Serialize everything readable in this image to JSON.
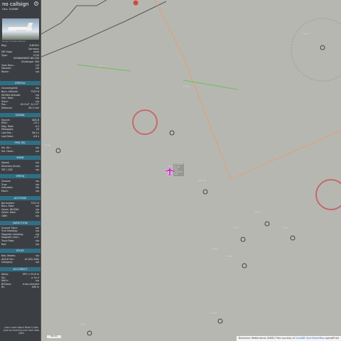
{
  "header": {
    "callsign": "no callsign",
    "hex_label": "Hex:",
    "hex": "3C6B8F"
  },
  "photo_credit": "Image © Günther Pleinen",
  "colors": {
    "sidebar_bg": "#3b3f44",
    "section_bg": "#2f6f86",
    "map_bg": "#b7b7b2",
    "aircraft": "#cc33cc",
    "restricted": "#c46a6a",
    "airway_orange": "#e0a070",
    "airway_green": "#6fbf4f",
    "border": "#555555"
  },
  "details": [
    {
      "k": "Reg.:",
      "v": "D-BGGG"
    },
    {
      "k": "",
      "v": "Germany"
    },
    {
      "k": "DB Flags:",
      "v": "none"
    },
    {
      "k": "Type:",
      "v": "CL30"
    },
    {
      "k": "",
      "v": "BOMBARDIER BD-100"
    },
    {
      "k": "",
      "v": "Challenger 300"
    },
    {
      "k": "Type Desc.:",
      "v": "L2J"
    },
    {
      "k": "Squawk:",
      "v": "n/a"
    },
    {
      "k": "Route:",
      "v": "n/a"
    }
  ],
  "sections": [
    {
      "title": "SPATIAL",
      "rows": [
        {
          "k": "Groundspeed:",
          "v": "n/a"
        },
        {
          "k": "Baro. Altitude:",
          "v": "7325 ft"
        },
        {
          "k": "WGS84 Altitude:",
          "v": "n/a"
        },
        {
          "k": "Vert. Rate:",
          "v": "n/a"
        },
        {
          "k": "Track:",
          "v": "n/a"
        },
        {
          "k": "Pos.:",
          "v": "49.214°, 8.111°"
        },
        {
          "k": "Distance:",
          "v": "60.3 nmi"
        }
      ]
    },
    {
      "title": "SIGNAL",
      "rows": [
        {
          "k": "Source:",
          "v": "ADS-B"
        },
        {
          "k": "RSSI:",
          "v": "-25.1"
        },
        {
          "k": "Msg. Rate:",
          "v": "0.3"
        },
        {
          "k": "Messages:",
          "v": "20"
        },
        {
          "k": "Last Pos.:",
          "v": "58.4 s"
        },
        {
          "k": "Last Seen:",
          "v": "0.6 s"
        }
      ]
    },
    {
      "title": "FMS SEL",
      "rows": [
        {
          "k": "Sel. Alt.:",
          "v": "n/a"
        },
        {
          "k": "Sel. Head.:",
          "v": "n/a"
        }
      ]
    },
    {
      "title": "WIND",
      "rows": [
        {
          "k": "Speed:",
          "v": "n/a"
        },
        {
          "k": "Direction (from):",
          "v": "n/a"
        },
        {
          "k": "TAT / OAT:",
          "v": "n/a"
        }
      ]
    },
    {
      "title": "SPEED",
      "rows": [
        {
          "k": "Ground:",
          "v": "n/a"
        },
        {
          "k": "True:",
          "v": "n/a"
        },
        {
          "k": "Indicated:",
          "v": "n/a"
        },
        {
          "k": "Mach:",
          "v": "n/a"
        }
      ]
    },
    {
      "title": "ALTITUDE",
      "rows": [
        {
          "k": "Barometric:",
          "v": "7325 ft"
        },
        {
          "k": "Baro. Rate:",
          "v": "n/a"
        },
        {
          "k": "Geom. WGS84:",
          "v": "n/a"
        },
        {
          "k": "Geom. Rate:",
          "v": "n/a"
        },
        {
          "k": "QNH:",
          "v": "n/a"
        }
      ]
    },
    {
      "title": "DIRECTION",
      "rows": [
        {
          "k": "Ground Track:",
          "v": "n/a"
        },
        {
          "k": "True Heading:",
          "v": "n/a"
        },
        {
          "k": "Magnetic Heading:",
          "v": "n/a"
        },
        {
          "k": "Magnetic Decl.:",
          "v": "2.3°"
        },
        {
          "k": "Track Rate:",
          "v": "n/a"
        },
        {
          "k": "Roll:",
          "v": "n/a"
        }
      ]
    },
    {
      "title": "STUFF",
      "rows": [
        {
          "k": "Nav. Modes:",
          "v": "n/a"
        },
        {
          "k": "ADS-B Ver.:",
          "v": "v0 (DO-260)"
        },
        {
          "k": "Category:",
          "v": "n/a"
        }
      ]
    },
    {
      "title": "ACCURACY",
      "rows": [
        {
          "k": "NACp:",
          "v": "EPU < 92.6 m"
        },
        {
          "k": "SIL:",
          "v": "≤ 1e-3"
        },
        {
          "k": "NACv:",
          "v": "n/a"
        },
        {
          "k": "NICbaro:",
          "v": "cross-checked"
        },
        {
          "k": "Rc:",
          "v": "186 m"
        }
      ]
    }
  ],
  "footer_note": "Learn more about Mode S data type by hovering over each data label",
  "aircraft_label": {
    "line1": "D-BGGG",
    "line2": "CL30",
    "line3": "n/a",
    "line4": "7325 ft",
    "line5": "n/a"
  },
  "map_labels": [
    "EDTH",
    "EDRA",
    "SPEYER",
    "EDRZ",
    "EDRN",
    "EDRY",
    "EDFM",
    "EDRV",
    "EDRD",
    "EDSW",
    "EDRP",
    "EDRW",
    "EDSL",
    "KARLSRUHE",
    "HOCKENHEIM",
    "BADEN"
  ],
  "attribution": {
    "text": "Deutscher Wetterdienst (DWD) Tiles courtesy of",
    "link1": "CartoDB",
    "link2": "OpenStreetMap",
    "tail": "openAIP.net"
  },
  "scale": "50 nmi"
}
